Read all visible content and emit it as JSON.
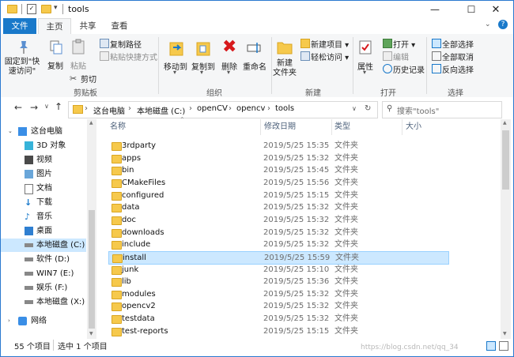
{
  "window": {
    "title": "tools",
    "minimize_glyph": "—",
    "maximize_glyph": "☐",
    "close_glyph": "✕"
  },
  "tabs": [
    "文件",
    "主页",
    "共享",
    "查看"
  ],
  "ribbon": {
    "pin_label": "固定到\"快\n速访问\"",
    "copy": "复制",
    "paste": "粘贴",
    "copy_path": "复制路径",
    "paste_shortcut": "粘贴快捷方式",
    "cut": "剪切",
    "group_clipboard": "剪贴板",
    "move_to": "移动到",
    "copy_to": "复制到",
    "delete": "删除",
    "rename": "重命名",
    "group_organize": "组织",
    "new_folder": "新建\n文件夹",
    "new_item": "新建项目 ▾",
    "easy_access": "轻松访问 ▾",
    "group_new": "新建",
    "properties": "属性",
    "open": "打开 ▾",
    "edit": "编辑",
    "history": "历史记录",
    "group_open": "打开",
    "select_all": "全部选择",
    "select_none": "全部取消",
    "invert": "反向选择",
    "group_select": "选择"
  },
  "address": {
    "crumbs": [
      "这台电脑",
      "本地磁盘 (C:)",
      "openCV",
      "opencv",
      "tools"
    ],
    "search_placeholder": "搜索\"tools\""
  },
  "nav": [
    {
      "label": "这台电脑"
    },
    {
      "label": "3D 对象"
    },
    {
      "label": "视频"
    },
    {
      "label": "图片"
    },
    {
      "label": "文档"
    },
    {
      "label": "下载"
    },
    {
      "label": "音乐"
    },
    {
      "label": "桌面"
    },
    {
      "label": "本地磁盘 (C:)"
    },
    {
      "label": "软件 (D:)"
    },
    {
      "label": "WIN7 (E:)"
    },
    {
      "label": "娱乐 (F:)"
    },
    {
      "label": "本地磁盘 (X:)"
    },
    {
      "label": "网络"
    }
  ],
  "columns": [
    "名称",
    "修改日期",
    "类型",
    "大小"
  ],
  "files": [
    {
      "name": "3rdparty",
      "date": "2019/5/25 15:35",
      "type": "文件夹"
    },
    {
      "name": "apps",
      "date": "2019/5/25 15:32",
      "type": "文件夹"
    },
    {
      "name": "bin",
      "date": "2019/5/25 15:45",
      "type": "文件夹"
    },
    {
      "name": "CMakeFiles",
      "date": "2019/5/25 15:56",
      "type": "文件夹"
    },
    {
      "name": "configured",
      "date": "2019/5/25 15:15",
      "type": "文件夹"
    },
    {
      "name": "data",
      "date": "2019/5/25 15:32",
      "type": "文件夹"
    },
    {
      "name": "doc",
      "date": "2019/5/25 15:32",
      "type": "文件夹"
    },
    {
      "name": "downloads",
      "date": "2019/5/25 15:32",
      "type": "文件夹"
    },
    {
      "name": "include",
      "date": "2019/5/25 15:32",
      "type": "文件夹"
    },
    {
      "name": "install",
      "date": "2019/5/25 15:59",
      "type": "文件夹"
    },
    {
      "name": "junk",
      "date": "2019/5/25 15:10",
      "type": "文件夹"
    },
    {
      "name": "lib",
      "date": "2019/5/25 15:36",
      "type": "文件夹"
    },
    {
      "name": "modules",
      "date": "2019/5/25 15:32",
      "type": "文件夹"
    },
    {
      "name": "opencv2",
      "date": "2019/5/25 15:32",
      "type": "文件夹"
    },
    {
      "name": "testdata",
      "date": "2019/5/25 15:32",
      "type": "文件夹"
    },
    {
      "name": "test-reports",
      "date": "2019/5/25 15:15",
      "type": "文件夹"
    }
  ],
  "status": {
    "count": "55 个项目",
    "selected": "选中 1 个项目"
  },
  "watermark": "https://blog.csdn.net/qq_34",
  "colors": {
    "accent": "#1979ca",
    "selection": "#cce8ff",
    "folder": "#f6c94c"
  }
}
